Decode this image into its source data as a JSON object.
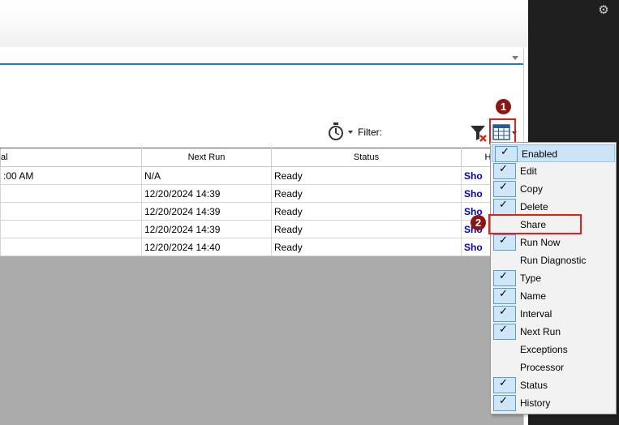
{
  "toolbar": {
    "timer_icon": "stopwatch-icon",
    "filter_label": "Filter:",
    "filter_value": "",
    "clear_filter_icon": "funnel-clear-icon",
    "columns_icon": "grid-columns-icon"
  },
  "callouts": {
    "one": "1",
    "two": "2"
  },
  "colors": {
    "highlight": "#e0201a",
    "callout": "#8b1616",
    "link": "#0000cc",
    "selection": "#cce4f7"
  },
  "grid": {
    "headers": [
      "al",
      "Next Run",
      "Status",
      "Hist"
    ],
    "rows": [
      [
        ":00 AM",
        "N/A",
        "Ready",
        "Sho"
      ],
      [
        "",
        "12/20/2024 14:39",
        "Ready",
        "Sho"
      ],
      [
        "",
        "12/20/2024 14:39",
        "Ready",
        "Sho"
      ],
      [
        "",
        "12/20/2024 14:39",
        "Ready",
        "Sho"
      ],
      [
        "",
        "12/20/2024 14:40",
        "Ready",
        "Sho"
      ]
    ]
  },
  "column_menu": {
    "items": [
      {
        "label": "Enabled",
        "checked": true,
        "selected": true
      },
      {
        "label": "Edit",
        "checked": true
      },
      {
        "label": "Copy",
        "checked": true
      },
      {
        "label": "Delete",
        "checked": true
      },
      {
        "label": "Share",
        "checked": false
      },
      {
        "label": "Run Now",
        "checked": true
      },
      {
        "label": "Run Diagnostic",
        "checked": false
      },
      {
        "label": "Type",
        "checked": true
      },
      {
        "label": "Name",
        "checked": true
      },
      {
        "label": "Interval",
        "checked": true
      },
      {
        "label": "Next Run",
        "checked": true
      },
      {
        "label": "Exceptions",
        "checked": false
      },
      {
        "label": "Processor",
        "checked": false
      },
      {
        "label": "Status",
        "checked": true
      },
      {
        "label": "History",
        "checked": true
      }
    ]
  }
}
